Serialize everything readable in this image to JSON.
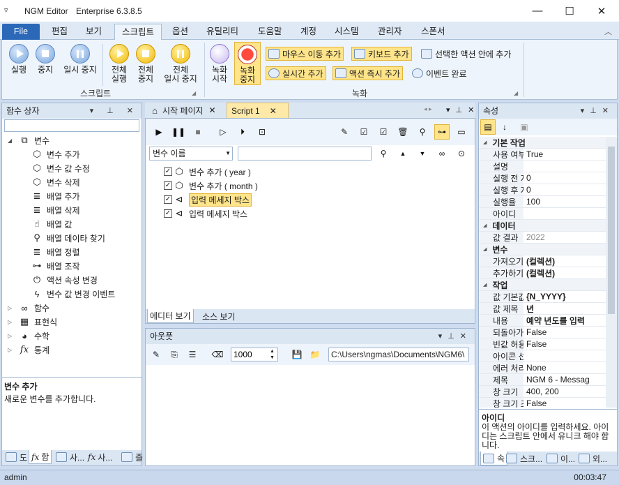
{
  "window": {
    "app_title": "NGM Editor",
    "edition": "Enterprise 6.3.8.5",
    "menu_glyph": "▿",
    "minimize": "—",
    "maximize": "☐",
    "close": "✕"
  },
  "ribbon_tabs": [
    "File",
    "편집",
    "보기",
    "스크립트",
    "옵션",
    "유틸리티",
    "도움말",
    "계정",
    "시스템",
    "관리자",
    "스폰서"
  ],
  "ribbon_collapse": "︿",
  "ribbon": {
    "script_group": {
      "label": "스크립트",
      "buttons": [
        {
          "label1": "실행",
          "label2": ""
        },
        {
          "label1": "중지",
          "label2": ""
        },
        {
          "label1": "일시 중지",
          "label2": ""
        },
        {
          "label1": "전체",
          "label2": "실행"
        },
        {
          "label1": "전체",
          "label2": "중지"
        },
        {
          "label1": "전체",
          "label2": "일시 중지"
        }
      ]
    },
    "record_group": {
      "label": "녹화",
      "record_start": {
        "label1": "녹화",
        "label2": "시작"
      },
      "record_stop": {
        "label1": "녹화",
        "label2": "중지"
      },
      "add_mouse": "마우스 이동 추가",
      "add_keyboard": "키보드 추가",
      "add_in_selected": "선택한 액션 안에 추가",
      "add_realtime": "실시간 추가",
      "add_action_now": "액션 즉시 추가",
      "event_done": "이벤트 완료"
    }
  },
  "function_box": {
    "title": "함수 상자",
    "search_value": "",
    "tree": {
      "root": "변수",
      "children": [
        "변수 추가",
        "변수 값 수정",
        "변수 삭제",
        "배열 추가",
        "배열 삭제",
        "배열 값",
        "배열 데이타 찾기",
        "배열 정렬",
        "배열 조작",
        "액션 속성 변경",
        "변수 값 변경 이벤트"
      ],
      "collapsed": [
        "함수",
        "표현식",
        "수학",
        "통계"
      ]
    },
    "desc_title": "변수 추가",
    "desc_text": "새로운 변수를 추가합니다.",
    "bottom_tabs": [
      "도",
      "함",
      "사...",
      "사...",
      "즐"
    ]
  },
  "editor": {
    "tabs": [
      {
        "label": "시작 페이지"
      },
      {
        "label": "Script 1"
      }
    ],
    "filter_select": "변수 이름",
    "filter_text": "",
    "lines": [
      {
        "text": "변수 추가 ( year )",
        "checked": true
      },
      {
        "text": "변수 추가 ( month )",
        "checked": true
      },
      {
        "text": "입력 메세지 박스",
        "checked": true
      },
      {
        "text": "입력 메세지 박스",
        "checked": true
      }
    ],
    "view_tabs": [
      "에디터 보기",
      "소스 보기"
    ]
  },
  "output": {
    "title": "아웃풋",
    "count": "1000",
    "path": "C:\\Users\\ngmas\\Documents\\NGM6\\"
  },
  "properties": {
    "title": "속성",
    "rows": [
      {
        "cat": "기본 작업"
      },
      {
        "name": "사용 여부",
        "value": "True"
      },
      {
        "name": "설명",
        "value": ""
      },
      {
        "name": "실행 전 지",
        "value": "0"
      },
      {
        "name": "실행 후 지",
        "value": "0"
      },
      {
        "name": "실행율",
        "value": "100"
      },
      {
        "name": "아이디",
        "value": ""
      },
      {
        "cat": "데이터"
      },
      {
        "name": "값 결과",
        "value": "2022",
        "gray": true
      },
      {
        "cat": "변수"
      },
      {
        "name": "가져오기",
        "value": "(컬렉션)",
        "bold": true
      },
      {
        "name": "추가하기",
        "value": "(컬렉션)",
        "bold": true
      },
      {
        "cat": "작업"
      },
      {
        "name": "값 기본값",
        "value": "{N_YYYY}",
        "bold": true
      },
      {
        "name": "값 제목",
        "value": "년",
        "bold": true
      },
      {
        "name": "내용",
        "value": "예약 년도를 입력",
        "bold": true
      },
      {
        "name": "되돌아가기",
        "value": "False"
      },
      {
        "name": "빈값 허용",
        "value": "False"
      },
      {
        "name": "아이콘 선택",
        "value": ""
      },
      {
        "name": "에러 처리",
        "value": "None"
      },
      {
        "name": "제목",
        "value": "NGM 6 - Messag"
      },
      {
        "name": "창 크기",
        "value": "400, 200"
      },
      {
        "name": "창 크기 조",
        "value": "False"
      }
    ],
    "help_title": "아이디",
    "help_text": "이 액션의 아이디를 입력하세요. 아이디는 스크립트 안에서 유니크 해야 합니다.",
    "bottom_tabs": [
      "속",
      "스크...",
      "이...",
      "외..."
    ]
  },
  "status": {
    "user": "admin",
    "time": "00:03:47"
  },
  "colors": {
    "accent": "#2b68b8",
    "highlight": "#ffe48a",
    "record": "#e8322b"
  }
}
